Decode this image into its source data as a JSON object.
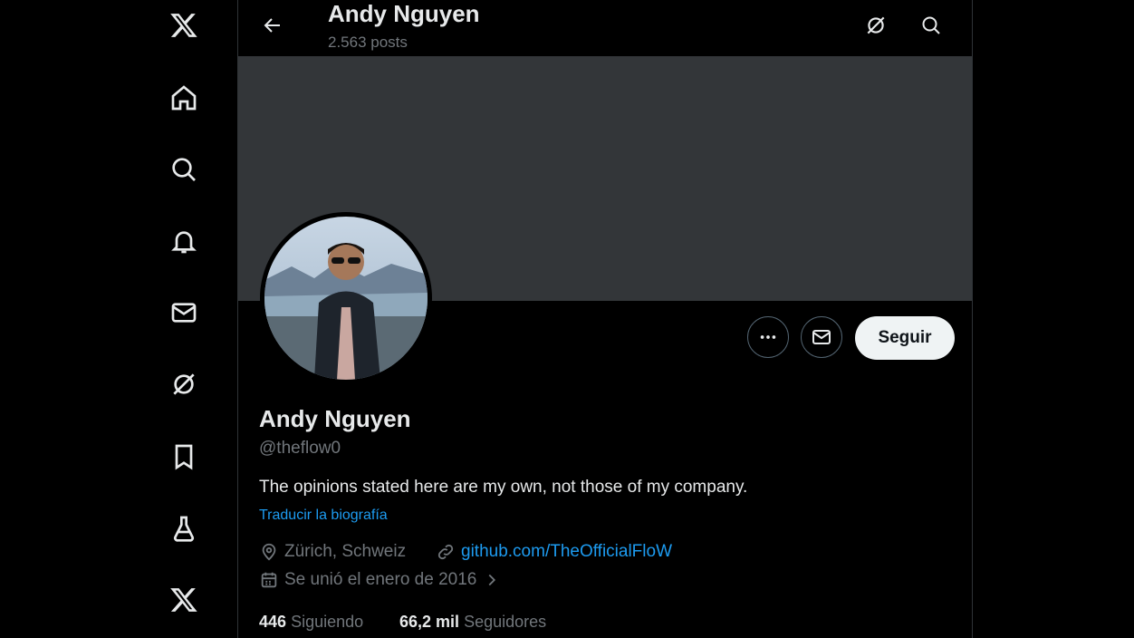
{
  "colors": {
    "background": "#000000",
    "banner": "#333639",
    "accent": "#1d9bf0",
    "text": "#e7e9ea",
    "muted": "#71767b"
  },
  "sidebar": {
    "items": [
      {
        "icon": "x-logo-icon"
      },
      {
        "icon": "home-icon"
      },
      {
        "icon": "search-icon"
      },
      {
        "icon": "bell-icon"
      },
      {
        "icon": "mail-icon"
      },
      {
        "icon": "grok-icon"
      },
      {
        "icon": "bookmark-icon"
      },
      {
        "icon": "flask-icon"
      },
      {
        "icon": "x-premium-icon"
      }
    ]
  },
  "header": {
    "title": "Andy Nguyen",
    "posts": "2.563 posts"
  },
  "profile": {
    "name": "Andy Nguyen",
    "handle": "@theflow0",
    "bio": "The opinions stated here are my own, not those of my company.",
    "translate_bio": "Traducir la biografía",
    "location": "Zürich, Schweiz",
    "website": "github.com/TheOfficialFloW",
    "joined": "Se unió el enero de 2016",
    "follow_label": "Seguir",
    "following_count": "446",
    "following_label": "Siguiendo",
    "followers_count": "66,2 mil",
    "followers_label": "Seguidores"
  }
}
